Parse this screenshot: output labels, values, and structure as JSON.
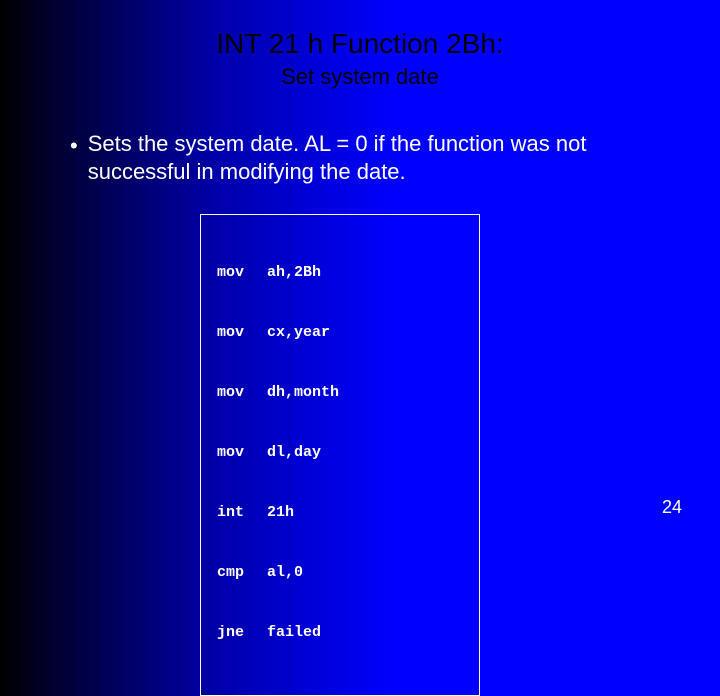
{
  "title": "INT 21 h Function 2Bh:",
  "subtitle": "Set system date",
  "bullet_text": "Sets the system date. AL = 0 if the function was not successful in modifying the date.",
  "code": [
    {
      "mnemonic": "mov",
      "operands": "ah,2Bh"
    },
    {
      "mnemonic": "mov",
      "operands": "cx,year"
    },
    {
      "mnemonic": "mov",
      "operands": "dh,month"
    },
    {
      "mnemonic": "mov",
      "operands": "dl,day"
    },
    {
      "mnemonic": "int",
      "operands": "21h"
    },
    {
      "mnemonic": "cmp",
      "operands": "al,0"
    },
    {
      "mnemonic": "jne",
      "operands": "failed"
    }
  ],
  "page_number": "24"
}
